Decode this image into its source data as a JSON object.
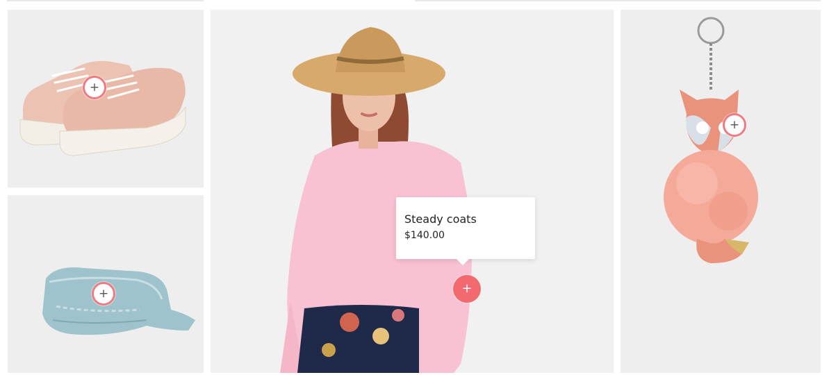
{
  "products": {
    "sneakers": {
      "icon": "sneakers-illustration",
      "hotspot_label": "+"
    },
    "bandana": {
      "icon": "bandana-illustration",
      "hotspot_label": "+"
    },
    "model": {
      "icon": "model-illustration",
      "hotspot_label": "+"
    },
    "keychain": {
      "icon": "fox-keychain-illustration",
      "hotspot_label": "+"
    }
  },
  "tooltip": {
    "title": "Steady coats",
    "price": "$140.00"
  },
  "colors": {
    "accent": "#f26a6f",
    "tile_bg": "#eeeeee",
    "sweater": "#f8c2d2",
    "shoe": "#ecc2b3"
  }
}
